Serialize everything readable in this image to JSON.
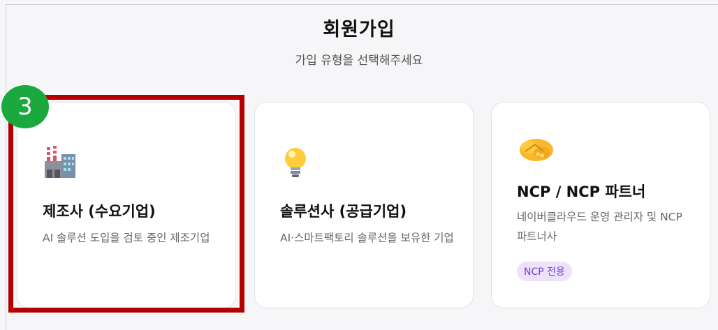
{
  "header": {
    "title": "회원가입",
    "subtitle": "가입 유형을 선택해주세요"
  },
  "cards": [
    {
      "icon": "factory-icon",
      "title": "제조사 (수요기업)",
      "description": "AI 솔루션 도입을 검토 중인 제조기업"
    },
    {
      "icon": "lightbulb-icon",
      "title": "솔루션사 (공급기업)",
      "description": "AI·스마트팩토리 솔루션을 보유한 기업"
    },
    {
      "icon": "handshake-icon",
      "title": "NCP / NCP 파트너",
      "description": "네이버클라우드 운영 관리자 및 NCP 파트너사",
      "badge": "NCP 전용"
    }
  ],
  "annotation": {
    "step_number": "3",
    "highlight_color": "#b30000",
    "step_color": "#1aa83f"
  }
}
